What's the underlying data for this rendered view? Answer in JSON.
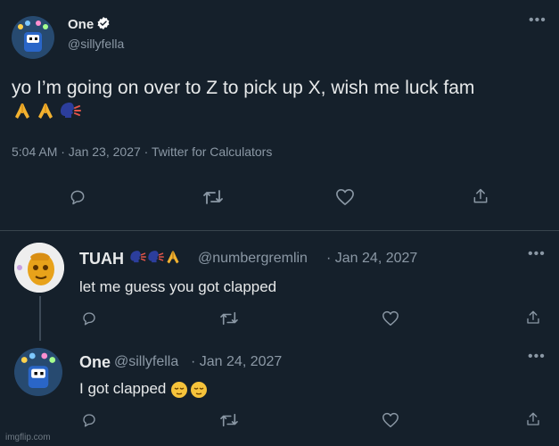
{
  "main_tweet": {
    "display_name": "One",
    "handle": "@sillyfella",
    "text": "yo I’m going on over to Z to pick up X, wish me luck fam",
    "meta": "5:04 AM · Jan 23, 2027 · Twitter for Calculators",
    "emojis": [
      "folded-hands",
      "folded-hands",
      "speaking-head"
    ],
    "verified": true
  },
  "reply1": {
    "display_name": "TUAH",
    "name_emojis": [
      "speaking-head",
      "speaking-head",
      "folded-hands"
    ],
    "handle": "@numbergremlin",
    "date": "· Jan 24, 2027",
    "text": "let me guess you got clapped"
  },
  "reply2": {
    "display_name": "One",
    "handle": "@sillyfella",
    "date": "· Jan 24, 2027",
    "text": "I got clapped",
    "emojis": [
      "relieved-face",
      "relieved-face"
    ]
  },
  "watermark": "imgflip.com",
  "colors": {
    "background": "#15202b",
    "text": "#e7e9ea",
    "muted": "#8b98a5",
    "verified": "#ffffff"
  }
}
